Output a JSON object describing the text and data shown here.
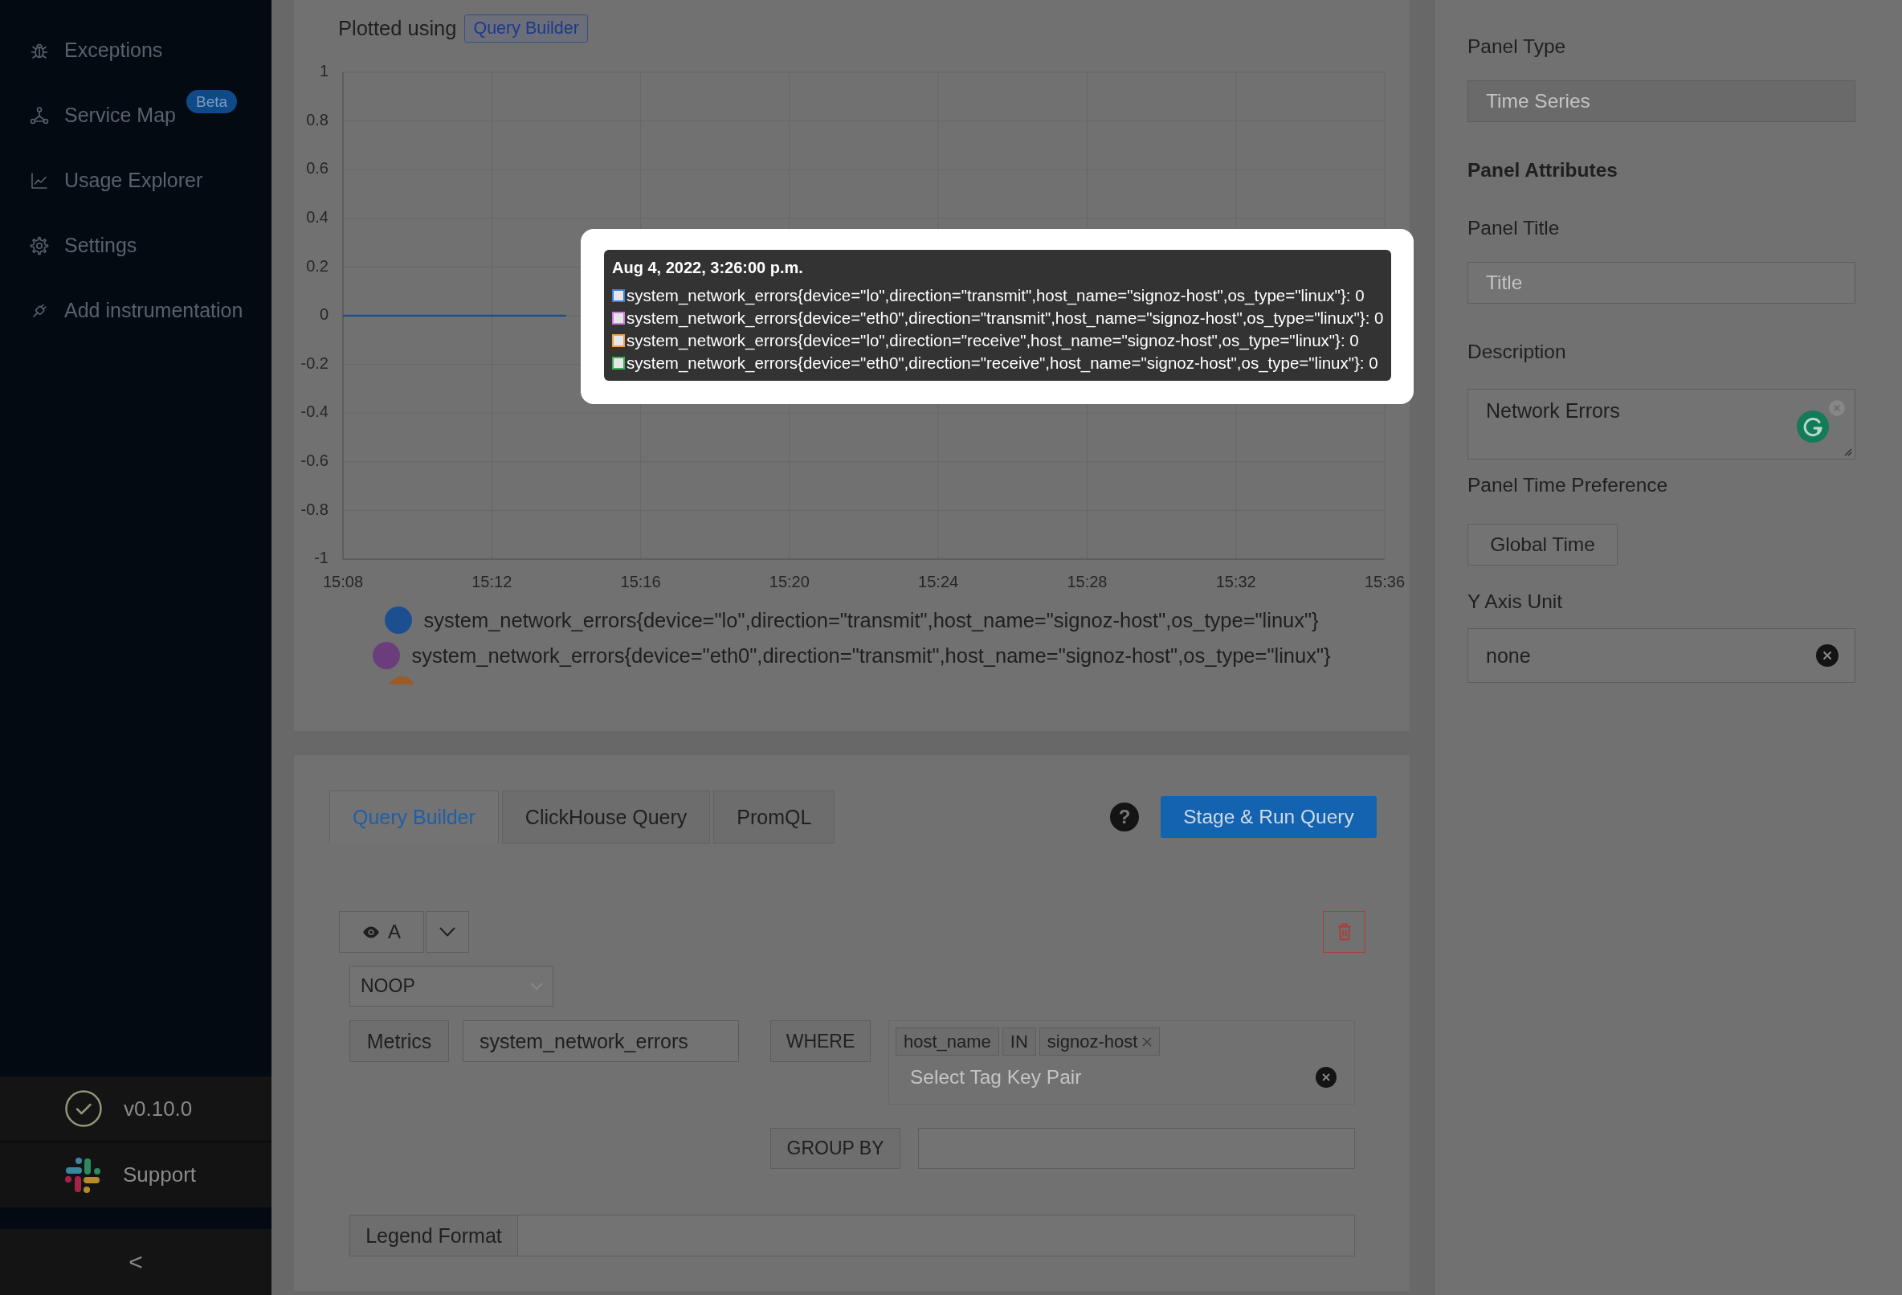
{
  "sidebar": {
    "items": [
      {
        "label": "Exceptions",
        "selected": false
      },
      {
        "label": "Service Map",
        "selected": false,
        "badge": "Beta"
      },
      {
        "label": "Usage Explorer",
        "selected": false
      },
      {
        "label": "Settings",
        "selected": false
      },
      {
        "label": "Add instrumentation",
        "selected": false
      }
    ],
    "version": "v0.10.0",
    "support": "Support",
    "collapse": "<"
  },
  "chart_panel": {
    "plotted_using": "Plotted using",
    "source": "Query Builder",
    "chart_data": {
      "type": "line",
      "grid": true,
      "categories": [
        "15:08",
        null,
        null,
        null,
        "15:12",
        null,
        null,
        null,
        "15:16",
        null,
        null,
        null,
        "15:20",
        null,
        null,
        null,
        "15:24",
        null,
        null,
        null,
        "15:28",
        null,
        null,
        null,
        "15:32",
        null,
        null,
        null,
        "15:36"
      ],
      "ylim": [
        -1,
        1
      ],
      "yticks": [
        1,
        0.8,
        0.6,
        0.4,
        0.2,
        0,
        -0.2,
        -0.4,
        -0.6,
        -0.8,
        -1
      ],
      "series": [
        {
          "name": "system_network_errors{device=\"lo\",direction=\"transmit\",host_name=\"signoz-host\",os_type=\"linux\"}",
          "color": "#1c4f8f",
          "values": [
            0,
            0,
            0,
            0,
            0,
            0,
            0,
            null,
            null,
            null,
            null,
            null,
            null,
            null,
            null,
            null,
            null,
            null,
            null,
            null,
            null,
            null,
            null,
            null,
            null,
            null,
            null,
            null,
            null
          ]
        },
        {
          "name": "system_network_errors{device=\"eth0\",direction=\"transmit\",host_name=\"signoz-host\",os_type=\"linux\"}",
          "color": "#6b3d7d",
          "values": [
            null,
            null,
            null,
            null,
            null,
            null,
            null,
            null,
            null,
            null,
            null,
            null,
            null,
            null,
            null,
            null,
            null,
            null,
            null,
            null,
            null,
            null,
            null,
            null,
            null,
            null,
            null,
            null,
            null
          ]
        },
        {
          "color": "#9c5b24",
          "values": [
            null,
            null,
            null,
            null,
            null,
            null,
            null,
            null,
            null,
            null,
            null,
            null,
            null,
            null,
            null,
            null,
            null,
            null,
            null,
            null,
            null,
            null,
            null,
            null,
            null,
            null,
            null,
            null,
            null
          ]
        }
      ]
    },
    "tooltip": {
      "title": "Aug 4, 2022, 3:26:00 p.m.",
      "rows": [
        {
          "text": "system_network_errors{device=\"lo\",direction=\"transmit\",host_name=\"signoz-host\",os_type=\"linux\"}: 0",
          "color": "#3b7ddd"
        },
        {
          "text": "system_network_errors{device=\"eth0\",direction=\"transmit\",host_name=\"signoz-host\",os_type=\"linux\"}: 0",
          "color": "#c383d6"
        },
        {
          "text": "system_network_errors{device=\"lo\",direction=\"receive\",host_name=\"signoz-host\",os_type=\"linux\"}: 0",
          "color": "#f0a050"
        },
        {
          "text": "system_network_errors{device=\"eth0\",direction=\"receive\",host_name=\"signoz-host\",os_type=\"linux\"}: 0",
          "color": "#3fae5a"
        }
      ]
    }
  },
  "query_panel": {
    "tabs": [
      {
        "label": "Query Builder",
        "selected": true
      },
      {
        "label": "ClickHouse Query",
        "selected": false
      },
      {
        "label": "PromQL",
        "selected": false
      }
    ],
    "help": "?",
    "run_button": "Stage & Run Query",
    "query": {
      "name": "A",
      "visible": true,
      "aggregation": "NOOP",
      "metrics_label": "Metrics",
      "metric": "system_network_errors",
      "where_label": "WHERE",
      "tags": [
        {
          "text": "host_name",
          "removable": false
        },
        {
          "text": "IN",
          "removable": false
        },
        {
          "text": "signoz-host",
          "removable": true
        }
      ],
      "tag_placeholder": "Select Tag Key Pair",
      "group_by_label": "GROUP BY",
      "legend_format_label": "Legend Format"
    }
  },
  "settings_panel": {
    "panel_type": {
      "label": "Panel Type",
      "value": "Time Series",
      "disabled": true
    },
    "attributes_heading": "Panel Attributes",
    "panel_title": {
      "label": "Panel Title",
      "placeholder": "Title"
    },
    "description": {
      "label": "Description",
      "value": "Network Errors"
    },
    "time_preference": {
      "label": "Panel Time Preference",
      "value": "Global Time"
    },
    "y_axis_unit": {
      "label": "Y Axis Unit",
      "value": "none"
    }
  }
}
